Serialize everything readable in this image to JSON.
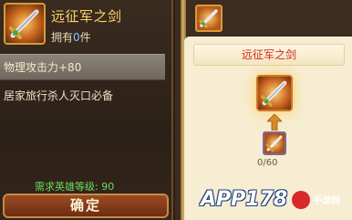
{
  "item_panel": {
    "name": "远征军之剑",
    "own_prefix": "拥有",
    "own_count": "0",
    "own_suffix": "件",
    "stat": "物理攻击力+80",
    "description": "居家旅行杀人灭口必备",
    "requirement": "需求英雄等级: 90",
    "confirm_label": "确定",
    "icon": "sword-icon"
  },
  "compose_panel": {
    "title": "远征军之剑",
    "target_icon": "sword-icon",
    "material_icon": "sword-fragment-icon",
    "material_count": "0/60",
    "arrow_icon": "arrow-up-icon"
  },
  "watermark": {
    "brand": "APP178",
    "sub": "手游网"
  },
  "colors": {
    "item_name": "#ffd36a",
    "own_count": "#7ec6ff",
    "requirement": "#6bdc57",
    "compose_title": "#d02a1a",
    "panel_bg": "#f6edd3"
  }
}
